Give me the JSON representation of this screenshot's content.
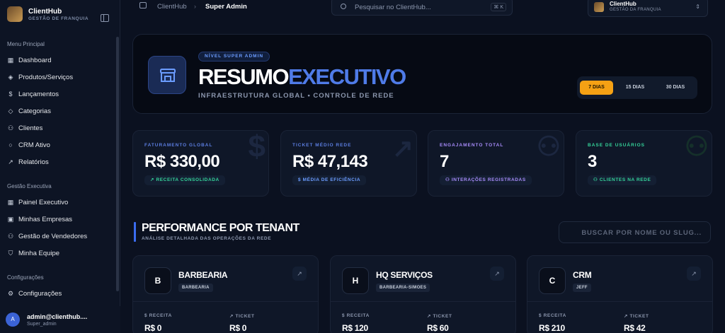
{
  "brand": {
    "name": "ClientHub",
    "subtitle": "GESTÃO DE FRANQUIA"
  },
  "sidebar": {
    "sections": [
      {
        "title": "Menu Principal",
        "items": [
          {
            "label": "Dashboard",
            "icon": "dashboard-icon"
          },
          {
            "label": "Produtos/Serviços",
            "icon": "package-icon"
          },
          {
            "label": "Lançamentos",
            "icon": "dollar-icon"
          },
          {
            "label": "Categorias",
            "icon": "tag-icon"
          },
          {
            "label": "Clientes",
            "icon": "users-icon"
          },
          {
            "label": "CRM Ativo",
            "icon": "chat-icon"
          },
          {
            "label": "Relatórios",
            "icon": "trend-icon"
          }
        ]
      },
      {
        "title": "Gestão Executiva",
        "items": [
          {
            "label": "Painel Executivo",
            "icon": "dashboard-icon"
          },
          {
            "label": "Minhas Empresas",
            "icon": "briefcase-icon"
          },
          {
            "label": "Gestão de Vendedores",
            "icon": "users-icon"
          },
          {
            "label": "Minha Equipe",
            "icon": "shield-icon"
          }
        ]
      },
      {
        "title": "Configurações",
        "items": [
          {
            "label": "Configurações",
            "icon": "gear-icon"
          }
        ]
      }
    ],
    "user": {
      "initial": "A",
      "email": "admin@clienthub....",
      "role": "Super_admin"
    }
  },
  "topbar": {
    "breadcrumb": [
      "ClientHub",
      "Super Admin"
    ],
    "search_placeholder": "Pesquisar no ClientHub...",
    "shortcut": "⌘ K",
    "tenant": {
      "name": "ClientHub",
      "subtitle": "GESTÃO DA FRANQUIA"
    }
  },
  "hero": {
    "badge": "NÍVEL SUPER ADMIN",
    "title_main": "RESUMO",
    "title_accent": "EXECUTIVO",
    "subtitle": "INFRAESTRUTURA GLOBAL • CONTROLE DE REDE",
    "periods": [
      "7 DIAS",
      "15 DIAS",
      "30 DIAS"
    ],
    "active_period": "7 DIAS"
  },
  "kpis": [
    {
      "label": "FATURAMENTO GLOBAL",
      "value": "R$ 330,00",
      "pill": "RECEITA CONSOLIDADA",
      "color": "#34d399",
      "label_color": "#5b7de0"
    },
    {
      "label": "TICKET MÉDIO REDE",
      "value": "R$ 47,143",
      "pill": "MÉDIA DE EFICIÊNCIA",
      "color": "#6b9cff",
      "label_color": "#5b7de0"
    },
    {
      "label": "ENGAJAMENTO TOTAL",
      "value": "7",
      "pill": "INTERAÇÕES REGISTRADAS",
      "color": "#a78bfa",
      "label_color": "#a78bfa"
    },
    {
      "label": "BASE DE USUÁRIOS",
      "value": "3",
      "pill": "CLIENTES NA REDE",
      "color": "#34d399",
      "label_color": "#34d399"
    }
  ],
  "performance": {
    "title": "PERFORMANCE POR TENANT",
    "subtitle": "ANÁLISE DETALHADA DAS OPERAÇÕES DA REDE",
    "search_placeholder": "BUSCAR POR NOME OU SLUG..."
  },
  "tenants": [
    {
      "letter": "B",
      "name": "BARBEARIA",
      "slug": "BARBEARIA",
      "revenue_label": "RECEITA",
      "revenue": "R$ 0",
      "ticket_label": "TICKET",
      "ticket": "R$ 0"
    },
    {
      "letter": "H",
      "name": "HQ SERVIÇOS",
      "slug": "BARBEARIA-SIMOES",
      "revenue_label": "RECEITA",
      "revenue": "R$ 120",
      "ticket_label": "TICKET",
      "ticket": "R$ 60"
    },
    {
      "letter": "C",
      "name": "CRM",
      "slug": "JEFF",
      "revenue_label": "RECEITA",
      "revenue": "R$ 210",
      "ticket_label": "TICKET",
      "ticket": "R$ 42"
    }
  ]
}
